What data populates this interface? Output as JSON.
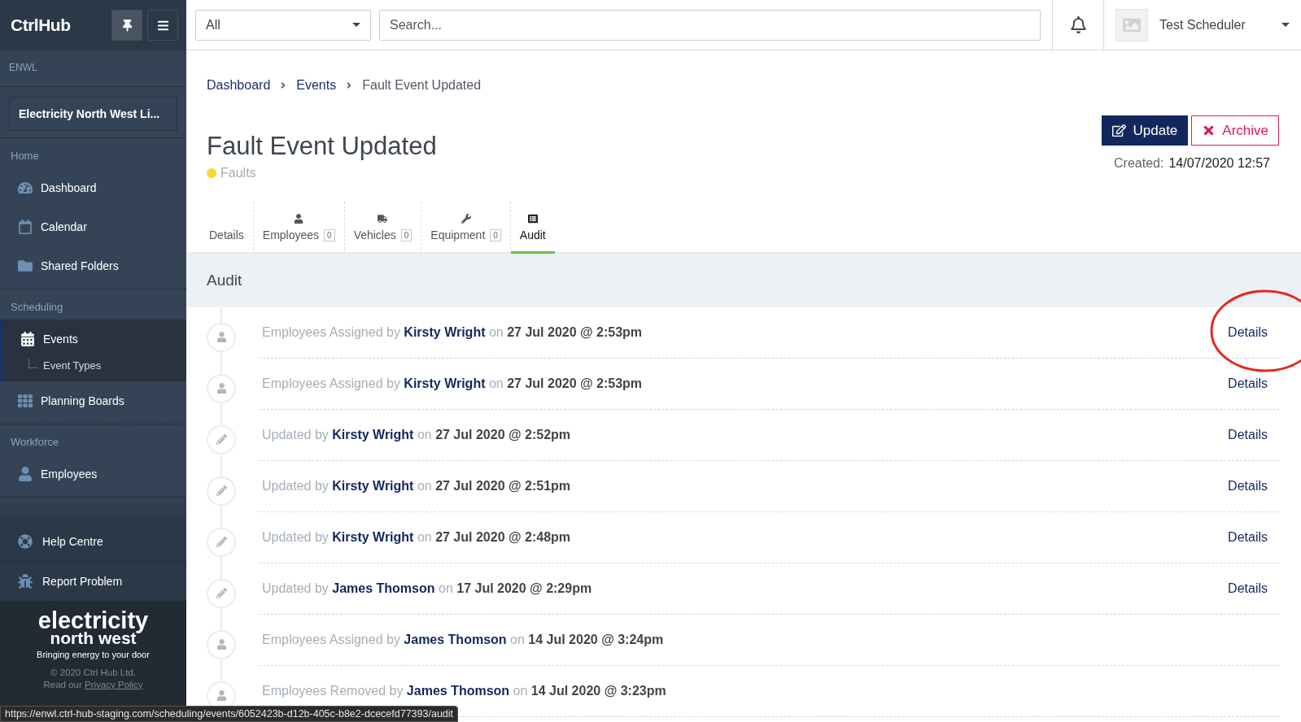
{
  "sidebar": {
    "brand": "CtrlHub",
    "org_label": "ENWL",
    "org_select": "Electricity North West Li...",
    "sections": [
      {
        "label": "Home",
        "items": [
          {
            "label": "Dashboard",
            "selected": false
          },
          {
            "label": "Calendar",
            "selected": false
          },
          {
            "label": "Shared Folders",
            "selected": false
          }
        ]
      },
      {
        "label": "Scheduling",
        "items": [
          {
            "label": "Events",
            "selected": true,
            "children": [
              {
                "label": "Event Types"
              }
            ]
          },
          {
            "label": "Planning Boards",
            "selected": false
          }
        ]
      },
      {
        "label": "Workforce",
        "items": [
          {
            "label": "Employees",
            "selected": false
          }
        ]
      }
    ],
    "support": [
      {
        "label": "Help Centre"
      },
      {
        "label": "Report Problem"
      }
    ],
    "logo": {
      "line_1": "electricity",
      "line_2": "north west",
      "tagline": "Bringing energy to your door"
    },
    "copyright": "© 2020 Ctrl Hub Ltd.",
    "privacy": {
      "prefix": "Read our",
      "link": "Privacy Policy"
    }
  },
  "topbar": {
    "scope": "All",
    "search": {
      "placeholder": "Search..."
    },
    "user": "Test Scheduler"
  },
  "breadcrumb": [
    {
      "label": "Dashboard",
      "current": false
    },
    {
      "label": "Events",
      "current": false
    },
    {
      "label": "Fault Event Updated",
      "current": true
    }
  ],
  "title": "Fault Event Updated",
  "category": {
    "label": "Faults",
    "color": "#f5dc2c"
  },
  "actions": {
    "update": "Update",
    "archive": "Archive"
  },
  "created": {
    "label": "Created:",
    "value": "14/07/2020 12:57"
  },
  "tabs": [
    {
      "label": "Details",
      "selected": false
    },
    {
      "label": "Employees",
      "count": "0",
      "selected": false
    },
    {
      "label": "Vehicles",
      "count": "0",
      "selected": false
    },
    {
      "label": "Equipment",
      "count": "0",
      "selected": false
    },
    {
      "label": "Audit",
      "selected": true
    }
  ],
  "audit": {
    "title": "Audit",
    "rows": [
      {
        "kind": "person",
        "text": "Employees Assigned by **Kirsty Wright** on **27 Jul 2020 @ 2:53pm**",
        "link": "Details"
      },
      {
        "kind": "person",
        "text": "Employees Assigned by **Kirsty Wright** on **27 Jul 2020 @ 2:53pm**",
        "link": "Details"
      },
      {
        "kind": "pencil",
        "text": "Updated by **Kirsty Wright** on **27 Jul 2020 @ 2:52pm**",
        "link": "Details"
      },
      {
        "kind": "pencil",
        "text": "Updated by **Kirsty Wright** on **27 Jul 2020 @ 2:51pm**",
        "link": "Details"
      },
      {
        "kind": "pencil",
        "text": "Updated by **Kirsty Wright** on **27 Jul 2020 @ 2:48pm**",
        "link": "Details"
      },
      {
        "kind": "pencil",
        "text": "Updated by **James Thomson** on **17 Jul 2020 @ 2:29pm**",
        "link": "Details"
      },
      {
        "kind": "person",
        "text": "Employees Assigned by **James Thomson** on **14 Jul 2020 @ 3:24pm**"
      },
      {
        "kind": "person",
        "text": "Employees Removed by **James Thomson** on **14 Jul 2020 @ 3:23pm**"
      }
    ]
  },
  "status_bar": {
    "url": "https://enwl.ctrl-hub-staging.com/scheduling/events/6052423b-d12b-405c-b8e2-dcecefd77393/audit"
  }
}
